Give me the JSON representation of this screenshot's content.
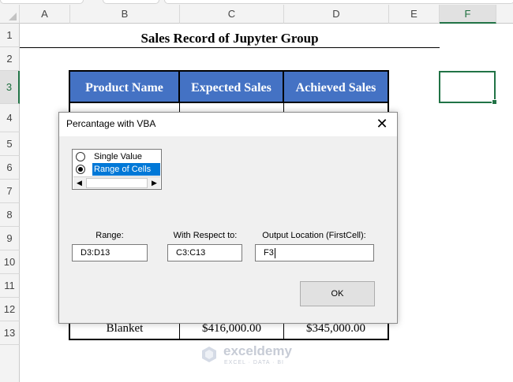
{
  "sheet": {
    "columns": [
      "",
      "A",
      "B",
      "C",
      "D",
      "E",
      "F"
    ],
    "rows": [
      "1",
      "2",
      "3",
      "4",
      "5",
      "6",
      "7",
      "8",
      "9",
      "10",
      "11",
      "12",
      "13"
    ],
    "title": "Sales Record of Jupyter Group",
    "table": {
      "headers": [
        "Product Name",
        "Expected Sales",
        "Achieved Sales"
      ],
      "last_row": {
        "product": "Blanket",
        "expected": "$416,000.00",
        "achieved": "$345,000.00"
      }
    }
  },
  "dialog": {
    "title": "Percantage with VBA",
    "close_icon": "close-icon",
    "options": [
      {
        "label": "Single Value",
        "checked": false
      },
      {
        "label": "Range of Cells",
        "checked": true
      }
    ],
    "fields": {
      "range": {
        "label": "Range:",
        "value": "D3:D13"
      },
      "respect": {
        "label": "With Respect to:",
        "value": "C3:C13"
      },
      "output": {
        "label": "Output Location (FirstCell):",
        "value": "F3"
      }
    },
    "ok_label": "OK"
  },
  "watermark": {
    "brand": "exceldemy",
    "tagline": "EXCEL · DATA · BI"
  },
  "colors": {
    "header_blue": "#4472c4",
    "excel_green": "#217346",
    "selection_blue": "#0078d7"
  }
}
